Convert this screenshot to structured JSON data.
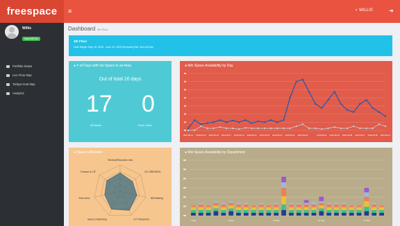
{
  "brand": "freespace",
  "topbar": {
    "user_name": "WILLIS"
  },
  "profile": {
    "name": "Willis",
    "status": "Space@Tide"
  },
  "nav": {
    "items": [
      {
        "label": "Portfolio Status"
      },
      {
        "label": "Live Floor Map"
      },
      {
        "label": "Todays Heat Map"
      },
      {
        "label": "Analytics"
      }
    ]
  },
  "page": {
    "title": "Dashboard",
    "subtitle": "4th Floor"
  },
  "info": {
    "title": "4th Floor",
    "detail": "Date Range: May 15, 2016 - June 10, 2016 (Excluding Sat, Sun) All Day"
  },
  "card1": {
    "title": "# of Days with No Space in an Area",
    "subtitle": "Out of total 20 days",
    "value_left": "17",
    "label_left": "All Areas",
    "value_right": "0",
    "label_right": "Exec. Area"
  },
  "card2": {
    "title": "Min Space Availability by Day"
  },
  "card3": {
    "title": "Space Utilisation"
  },
  "card4": {
    "title": "Min Space Availability by Department"
  },
  "chart_data": [
    {
      "type": "line",
      "title": "Min Space Availability by Day",
      "x": [
        "2016-05-11",
        "2016-05-12",
        "2016-05-13",
        "2016-05-14",
        "2016-05-15",
        "2016-05-16",
        "2016-05-17",
        "2016-05-18",
        "2016-05-19",
        "2016-05-20",
        "2016-05-21",
        "2016-05-22",
        "2016-05-23",
        "2016-05-24",
        "2016-05-25",
        "2016-05-26",
        "2016-05-27",
        "2016-05-28",
        "2016-05-29",
        "2016-05-30",
        "2016-05-31",
        "2016-06-01",
        "2016-06-02",
        "2016-06-03",
        "2016-06-04",
        "2016-06-05",
        "2016-06-06",
        "2016-06-07",
        "2016-06-08",
        "2016-06-09",
        "2016-06-10",
        "2016-06-11"
      ],
      "tick_labels": [
        "2016-05-11",
        "2016-05-13",
        "2016-05-15",
        "2016-05-17",
        "2016-05-19",
        "2016-05-21",
        "2016-05-23",
        "2016-05-25",
        "2016-05-27",
        "2016-05-29",
        "2016-06-01",
        "2016-06-03",
        "2016-06-05",
        "2016-06-07",
        "2016-06-09",
        "2016-06-11"
      ],
      "ylim": [
        0,
        140
      ],
      "series": [
        {
          "values": [
            5,
            25,
            15,
            18,
            20,
            25,
            20,
            24,
            20,
            25,
            18,
            22,
            20,
            25,
            20,
            25,
            80,
            120,
            125,
            95,
            65,
            55,
            75,
            95,
            65,
            50,
            45,
            65,
            75,
            55,
            45,
            35
          ]
        },
        {
          "values": [
            0,
            0,
            10,
            5,
            5,
            8,
            5,
            5,
            3,
            6,
            5,
            5,
            5,
            5,
            5,
            5,
            5,
            10,
            15,
            5,
            5,
            3,
            5,
            8,
            5,
            5,
            10,
            5,
            5,
            5,
            15,
            10
          ]
        }
      ],
      "colors": [
        "#2e57a8",
        "#cccccc"
      ]
    },
    {
      "type": "radar",
      "title": "Space Utilisation",
      "categories": [
        "Terminal/Financial Lines",
        "GC GREEN/FA",
        "NB Building",
        "ICT Placement",
        "Sales & Marketing",
        "Exec Area",
        "Finance & CIF"
      ],
      "values": [
        70,
        60,
        65,
        80,
        75,
        60,
        65
      ]
    },
    {
      "type": "bar",
      "stacked": true,
      "title": "Min Space Availability by Department",
      "categories": [
        "7 May",
        "",
        "",
        "",
        "",
        "9 May",
        "",
        "",
        "",
        "",
        "",
        "11 May",
        "",
        "",
        "",
        "",
        "",
        "13 May",
        "",
        "",
        "",
        "",
        "",
        "17 May",
        "",
        ""
      ],
      "ylim": [
        0,
        100
      ],
      "series": [
        {
          "values": [
            5,
            5,
            5,
            8,
            5,
            8,
            5,
            5,
            5,
            5,
            5,
            5,
            10,
            5,
            5,
            5,
            5,
            8,
            5,
            5,
            5,
            5,
            5,
            8,
            5,
            5
          ],
          "color": "#1f3f8f"
        },
        {
          "values": [
            5,
            5,
            5,
            5,
            5,
            5,
            5,
            5,
            5,
            5,
            5,
            5,
            10,
            5,
            5,
            5,
            5,
            5,
            5,
            5,
            5,
            5,
            5,
            8,
            5,
            5
          ],
          "color": "#3fbf8f"
        },
        {
          "values": [
            5,
            5,
            5,
            5,
            5,
            5,
            5,
            5,
            5,
            5,
            5,
            5,
            15,
            5,
            5,
            5,
            5,
            5,
            5,
            5,
            5,
            5,
            5,
            10,
            5,
            5
          ],
          "color": "#f0c030"
        },
        {
          "values": [
            3,
            5,
            3,
            5,
            5,
            5,
            5,
            5,
            3,
            5,
            3,
            5,
            15,
            5,
            5,
            5,
            5,
            5,
            5,
            5,
            5,
            3,
            3,
            8,
            5,
            3
          ],
          "color": "#f07f4f"
        },
        {
          "values": [
            0,
            3,
            0,
            3,
            3,
            3,
            3,
            3,
            0,
            3,
            0,
            3,
            10,
            3,
            3,
            3,
            5,
            3,
            3,
            3,
            3,
            0,
            0,
            8,
            3,
            0
          ],
          "color": "#a0b8d8"
        },
        {
          "values": [
            0,
            0,
            0,
            0,
            0,
            0,
            0,
            0,
            0,
            0,
            0,
            0,
            10,
            0,
            0,
            5,
            0,
            8,
            0,
            0,
            0,
            0,
            0,
            8,
            0,
            0
          ],
          "color": "#9b59d0"
        }
      ]
    }
  ]
}
